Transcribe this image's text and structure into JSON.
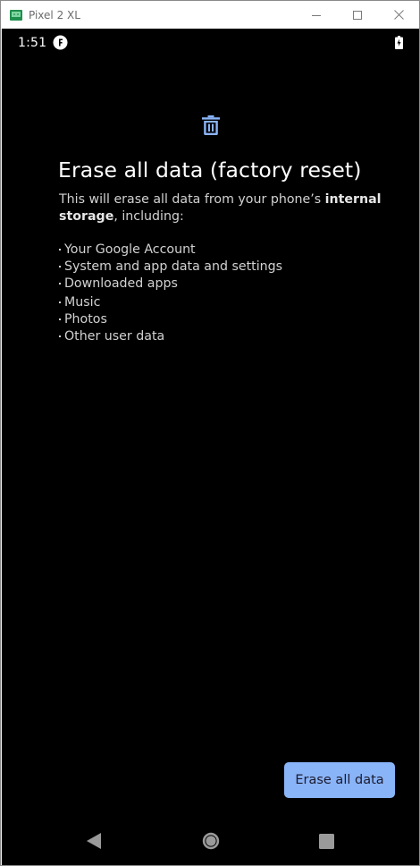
{
  "window": {
    "title": "Pixel 2 XL",
    "controls": [
      "minimize",
      "maximize",
      "close"
    ]
  },
  "statusbar": {
    "time": "1:51",
    "icons": [
      "notification-f-icon",
      "battery-charging-icon"
    ]
  },
  "content": {
    "icon": "trash-icon",
    "title": "Erase all data (factory reset)",
    "description_prefix": "This will erase all data from your phone’s ",
    "description_bold": "internal storage",
    "description_suffix": ", including:",
    "items": [
      "Your Google Account",
      "System and app data and settings",
      "Downloaded apps",
      "Music",
      "Photos",
      "Other user data"
    ]
  },
  "actions": {
    "erase_label": "Erase all data"
  },
  "navbar": {
    "icons": [
      "back-icon",
      "home-icon",
      "recents-icon"
    ]
  },
  "colors": {
    "accent": "#8ab4f8",
    "background": "#000000",
    "text": "#d2d2d2"
  }
}
